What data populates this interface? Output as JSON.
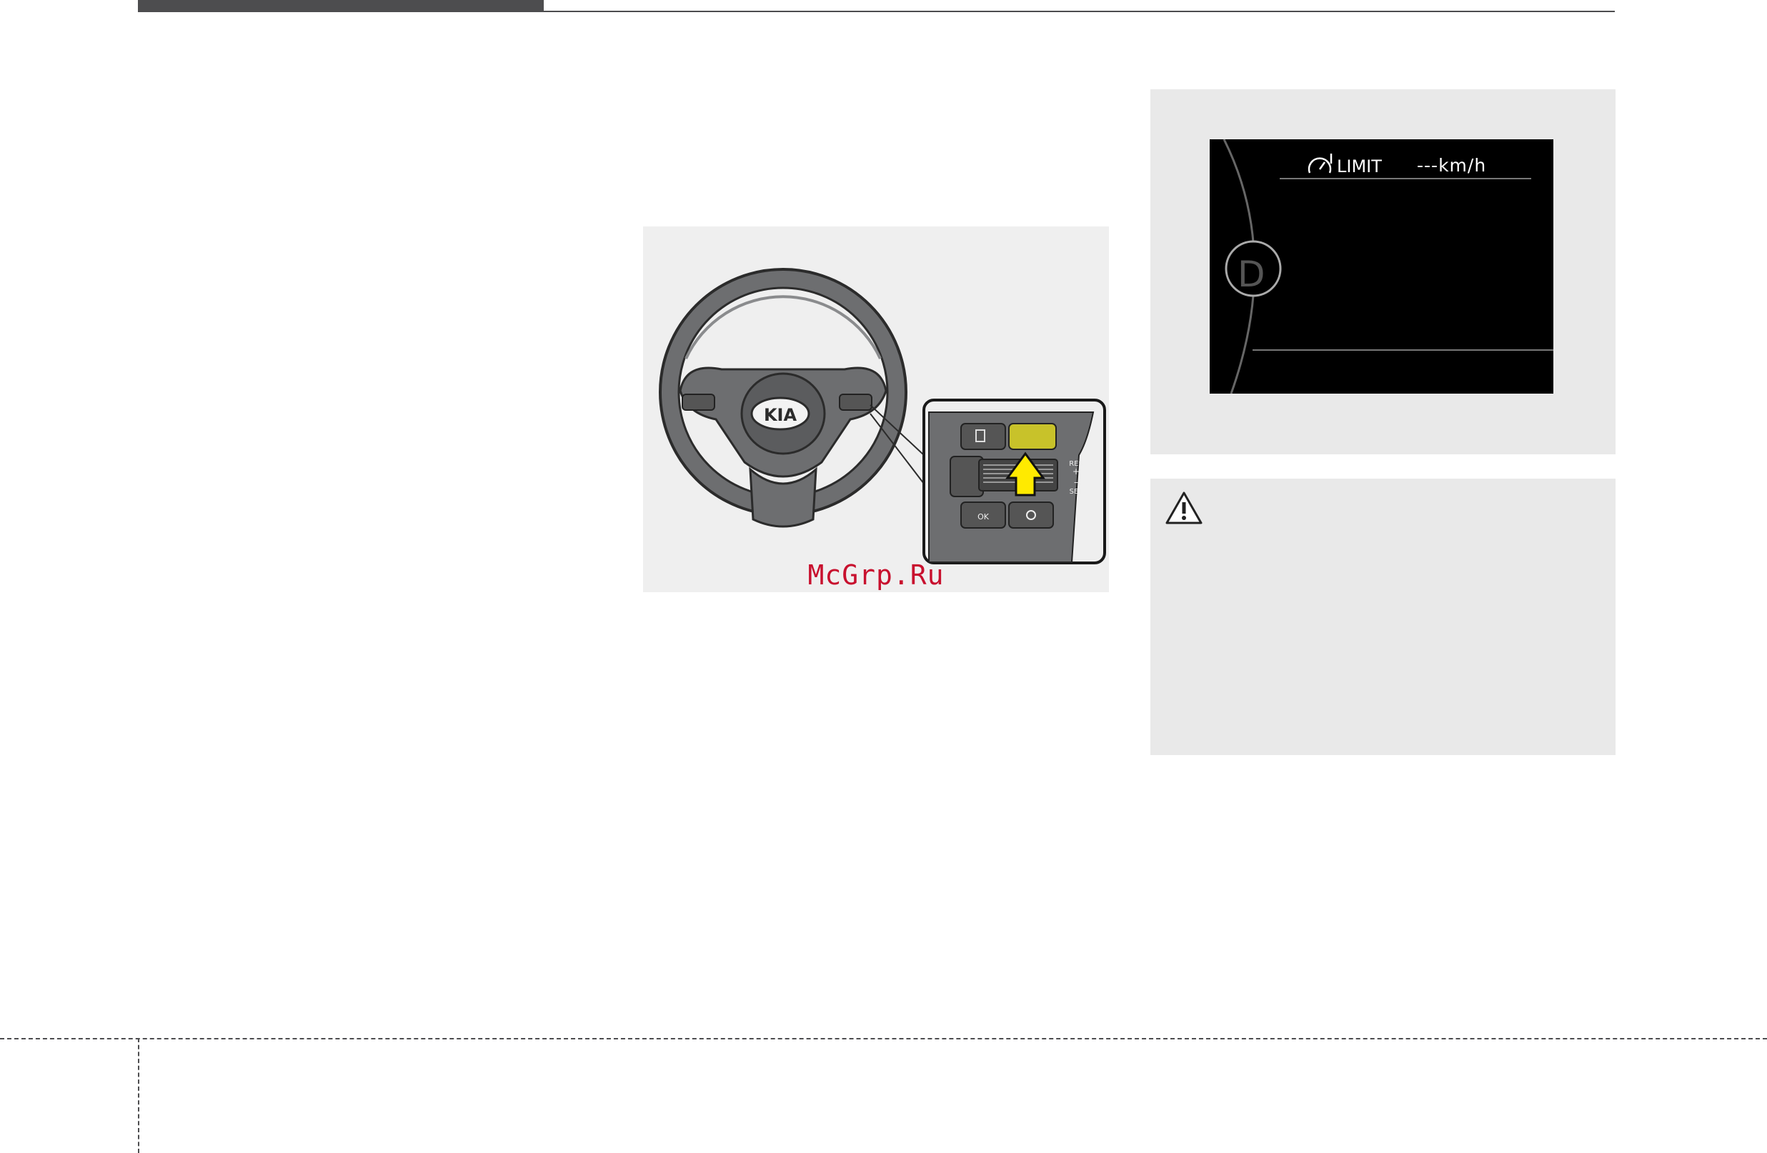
{
  "figure_wheel": {
    "logo_text": "KIA",
    "inset_buttons": {
      "ok_label": "OK",
      "res_label": "RES",
      "plus_label": "+",
      "minus_label": "–",
      "set_label": "SET"
    },
    "watermark": "McGrp.Ru",
    "colors": {
      "arrow": "#ffea00",
      "button_highlight": "#c8c22a"
    }
  },
  "figure_cluster": {
    "limit_label": "LIMIT",
    "limit_value": "---km/h",
    "gear_letter": "D",
    "icon": "speedometer-limit-icon"
  },
  "caution": {
    "icon": "caution-triangle-icon"
  }
}
